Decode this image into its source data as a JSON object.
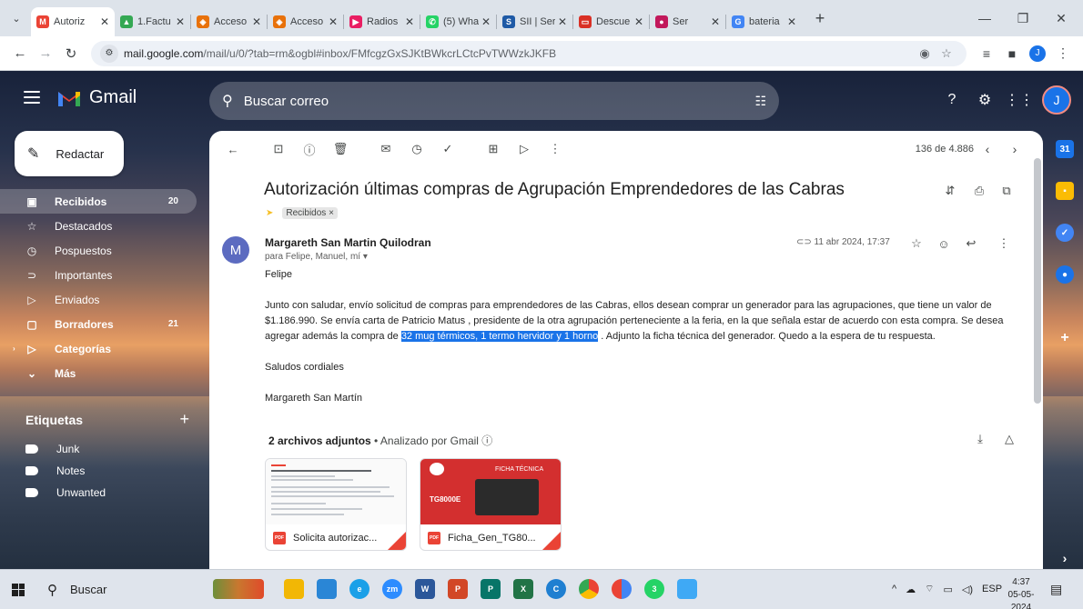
{
  "browser": {
    "tabs": [
      {
        "title": "Autoriz",
        "favicon": "gmail-icon",
        "color": "#ea4335",
        "glyph": "M",
        "active": true
      },
      {
        "title": "1.Factu",
        "favicon": "drive-icon",
        "color": "#34a853",
        "glyph": "▲"
      },
      {
        "title": "Acceso",
        "favicon": "portal-icon",
        "color": "#e8710a",
        "glyph": "◈"
      },
      {
        "title": "Acceso",
        "favicon": "portal-icon",
        "color": "#e8710a",
        "glyph": "◈"
      },
      {
        "title": "Radios",
        "favicon": "radio-icon",
        "color": "#e91e63",
        "glyph": "▶"
      },
      {
        "title": "(5) Wha",
        "favicon": "whatsapp-icon",
        "color": "#25d366",
        "glyph": "✆"
      },
      {
        "title": "SII | Ser",
        "favicon": "sii-icon",
        "color": "#1f5aa6",
        "glyph": "S"
      },
      {
        "title": "Descue",
        "favicon": "discount-icon",
        "color": "#d93025",
        "glyph": "▭"
      },
      {
        "title": "Ser",
        "favicon": "series-icon",
        "color": "#c2185b",
        "glyph": "●"
      },
      {
        "title": "bateria",
        "favicon": "google-icon",
        "color": "#4285f4",
        "glyph": "G"
      }
    ],
    "url_host": "mail.google.com",
    "url_path": "/mail/u/0/?tab=rm&ogbl#inbox/FMfcgzGxSJKtBWkcrLCtcPvTWWzkJKFB",
    "profile_initial": "J"
  },
  "gmail": {
    "app_name": "Gmail",
    "search_placeholder": "Buscar correo",
    "account_initial": "J",
    "compose_label": "Redactar",
    "nav": [
      {
        "label": "Recibidos",
        "count": "20",
        "icon": "inbox-icon",
        "glyph": "▣",
        "active": true
      },
      {
        "label": "Destacados",
        "count": "",
        "icon": "star-icon",
        "glyph": "☆"
      },
      {
        "label": "Pospuestos",
        "count": "",
        "icon": "clock-icon",
        "glyph": "◷"
      },
      {
        "label": "Importantes",
        "count": "",
        "icon": "important-icon",
        "glyph": "⊃"
      },
      {
        "label": "Enviados",
        "count": "",
        "icon": "send-icon",
        "glyph": "▷"
      },
      {
        "label": "Borradores",
        "count": "21",
        "icon": "draft-icon",
        "glyph": "▢",
        "bold": true
      },
      {
        "label": "Categorías",
        "count": "",
        "icon": "label-icon",
        "glyph": "▷",
        "bold": true,
        "caret": true
      },
      {
        "label": "Más",
        "count": "",
        "icon": "chevron-down-icon",
        "glyph": "⌄",
        "bold": true
      }
    ],
    "labels_title": "Etiquetas",
    "labels": [
      "Junk",
      "Notes",
      "Unwanted"
    ]
  },
  "message": {
    "pager": "136 de 4.886",
    "subject": "Autorización últimas compras de Agrupación Emprendedores de las Cabras",
    "label_chip": "Recibidos ×",
    "sender_initial": "M",
    "sender_name": "Margareth San Martin Quilodran",
    "recipients": "para Felipe, Manuel, mí ▾",
    "date": "11 abr 2024, 17:37",
    "greeting": "Felipe",
    "body_1": "Junto con saludar, envío solicitud de compras para emprendedores de las Cabras, ellos desean comprar un generador para las agrupaciones, que tiene un valor de $1.186.990. Se envía carta de Patricio Matus , presidente de la otra agrupación perteneciente a la feria, en la que señala estar de acuerdo con esta compra. Se desea agregar además la compra de ",
    "body_highlight": "32 mug térmicos, 1 termo hervidor y 1 horno",
    "body_2": " . Adjunto la ficha técnica del generador. Quedo a la espera de tu respuesta.",
    "closing": "Saludos cordiales",
    "signature": "Margareth San Martín",
    "attachments_title": "2 archivos adjuntos",
    "attachments_scan": " • Analizado por Gmail ⓘ",
    "attachments": [
      {
        "name": "Solicita autorizac...",
        "type": "PDF"
      },
      {
        "name": "Ficha_Gen_TG80...",
        "type": "PDF",
        "thumb_title": "FICHA TÉCNICA",
        "thumb_model": "TG8000E"
      }
    ]
  },
  "taskbar": {
    "search_label": "Buscar",
    "language": "ESP",
    "time": "4:37",
    "date": "05-05-2024"
  }
}
